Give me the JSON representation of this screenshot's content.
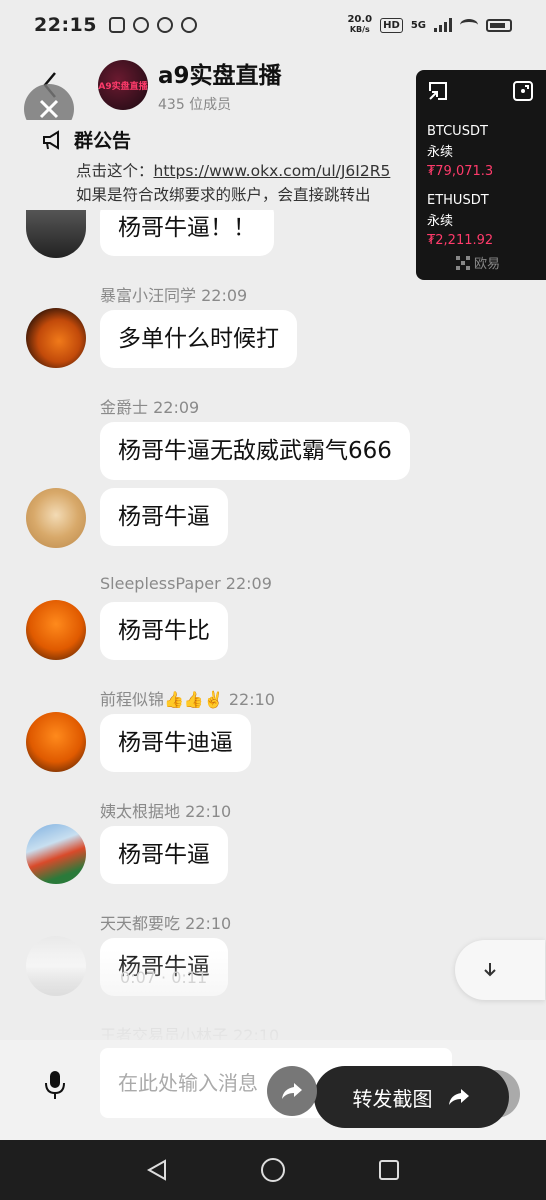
{
  "status_bar": {
    "time": "22:15",
    "net_speed_value": "20.0",
    "net_speed_unit": "KB/s",
    "hd": "HD",
    "signal": "5G",
    "battery": "38"
  },
  "header": {
    "group_avatar_text": "A9实盘直播",
    "title": "a9实盘直播",
    "member_count": "435 位成员"
  },
  "announcement": {
    "title": "群公告",
    "line1_prefix": "点击这个：",
    "line1_link": "https://www.okx.com/ul/J6I2R5",
    "line2": "如果是符合改绑要求的账户，会直接跳转出"
  },
  "messages": [
    {
      "name": "",
      "text": "杨哥牛逼！！",
      "avatar": "dark"
    },
    {
      "name": "暴富小汪同学 22:09",
      "text": "多单什么时候打",
      "avatar": "bull"
    },
    {
      "name": "金爵士 22:09",
      "text": "杨哥牛逼无敌威武霸气666",
      "avatar": ""
    },
    {
      "name": "",
      "text": "杨哥牛逼",
      "avatar": "dog"
    },
    {
      "name": "SleeplessPaper 22:09",
      "text": "杨哥牛比",
      "avatar": "fire"
    },
    {
      "name": "前程似锦👍👍✌️ 22:10",
      "text": "杨哥牛迪逼",
      "avatar": "fire"
    },
    {
      "name": "姨太根据地 22:10",
      "text": "杨哥牛逼",
      "avatar": "build"
    },
    {
      "name": "天天都要吃 22:10",
      "text": "杨哥牛逼",
      "avatar": "car"
    },
    {
      "name": "王者交易员小林子 22:10",
      "text": "",
      "avatar": ""
    }
  ],
  "voice_time": "0:07 · 0:11",
  "ticker": {
    "items": [
      {
        "symbol": "BTCUSDT",
        "type": "永续",
        "price": "₮79,071.3"
      },
      {
        "symbol": "ETHUSDT",
        "type": "永续",
        "price": "₮2,211.92"
      }
    ],
    "brand": "欧易",
    "price_color": "#ff3b6b"
  },
  "input": {
    "placeholder": "在此处输入消息"
  },
  "forward_button": {
    "label": "转发截图"
  },
  "colors": {
    "background": "#ededed",
    "bubble": "#ffffff",
    "ticker_bg": "#151515",
    "forward_bg": "#262626"
  }
}
